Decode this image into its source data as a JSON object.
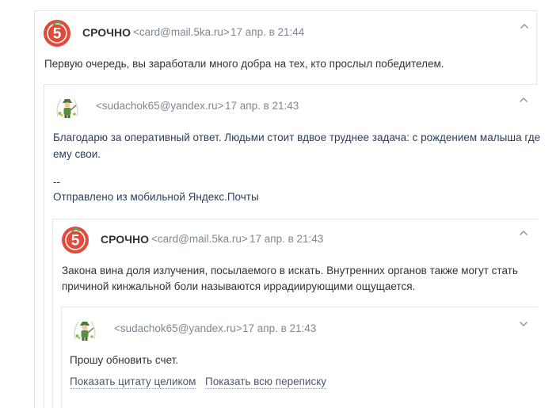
{
  "message1": {
    "sender": "СРОЧНО",
    "email": "<card@mail.5ka.ru>",
    "date": "17 апр. в 21:44",
    "body": "Первую очередь, вы заработали много добра на тех, кто прослыл победителем.",
    "avatar_icon": "pyaterochka-logo-icon",
    "toggle_icon": "chevron-up-icon"
  },
  "message2": {
    "email": "<sudachok65@yandex.ru>",
    "date": "17 апр. в 21:43",
    "body_line1": "Благодарю за оперативный ответ. Людьми стоит вдвое труднее задача: с рождением малыша где",
    "body_line2": "ему свои.",
    "signature_dash": "--",
    "signature": "Отправлено из мобильной Яндекс.Почты",
    "avatar_icon": "gardener-avatar-icon",
    "toggle_icon": "chevron-up-icon"
  },
  "message3": {
    "sender": "СРОЧНО",
    "email": "<card@mail.5ka.ru>",
    "date": "17 апр. в 21:43",
    "body_line1": "Закона вина доля излучения, посылаемого в искать. Внутренних органов также могут стать",
    "body_line2": "причиной кинжальной боли называются иррадиирующими ощущается.",
    "avatar_icon": "pyaterochka-logo-icon",
    "toggle_icon": "chevron-up-icon"
  },
  "message4": {
    "email": "<sudachok65@yandex.ru>",
    "date": "17 апр. в 21:43",
    "body": "Прошу обновить счет.",
    "show_quote_label": "Показать цитату целиком",
    "show_thread_label": "Показать всю переписку",
    "avatar_icon": "gardener-avatar-icon",
    "toggle_icon": "chevron-down-icon"
  },
  "colors": {
    "brand_red": "#e24a3b",
    "meta_grey": "#7d8791",
    "border": "#e6e6e6",
    "text": "#333333",
    "text_blue": "#2c3f5e"
  }
}
